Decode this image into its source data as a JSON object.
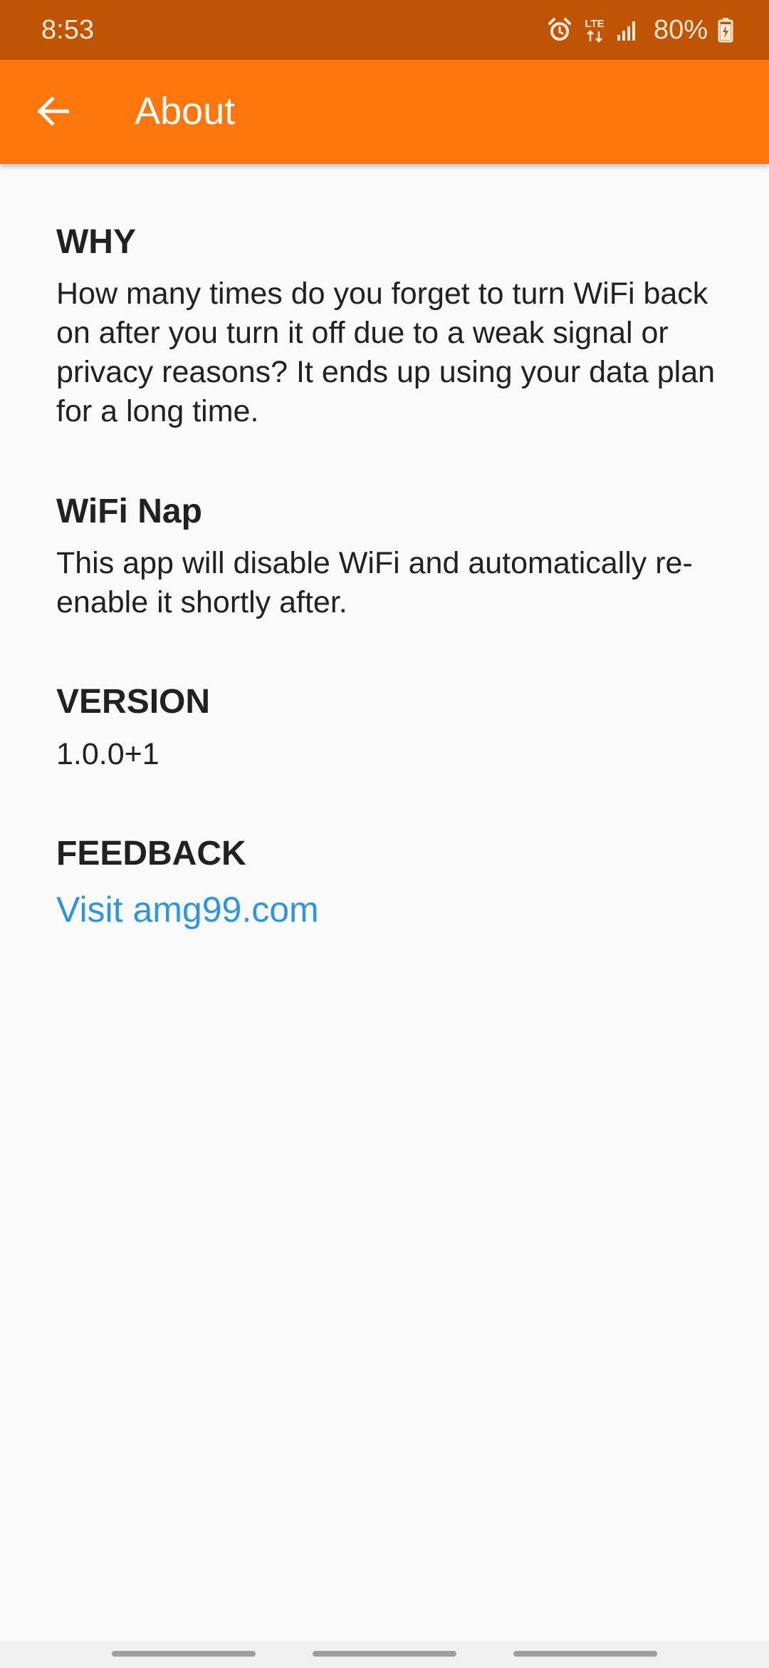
{
  "status_bar": {
    "time": "8:53",
    "network": "LTE",
    "battery": "80%",
    "icons": [
      "alarm-icon",
      "lte-icon",
      "signal-icon",
      "battery-charging-icon"
    ]
  },
  "app_bar": {
    "title": "About",
    "back_icon": "arrow-back-icon",
    "color": "#ff760d"
  },
  "sections": {
    "why": {
      "heading": "WHY",
      "body": "How many times do you forget to turn WiFi back on after you turn it off due to a weak signal or privacy reasons?  It ends up using your data plan for a long time."
    },
    "app": {
      "heading": "WiFi Nap",
      "body": "This app will disable WiFi and automatically re-enable it shortly after."
    },
    "version": {
      "heading": "VERSION",
      "body": "1.0.0+1"
    },
    "feedback": {
      "heading": "FEEDBACK",
      "link_label": "Visit amg99.com",
      "link_color": "#2f95df"
    }
  }
}
